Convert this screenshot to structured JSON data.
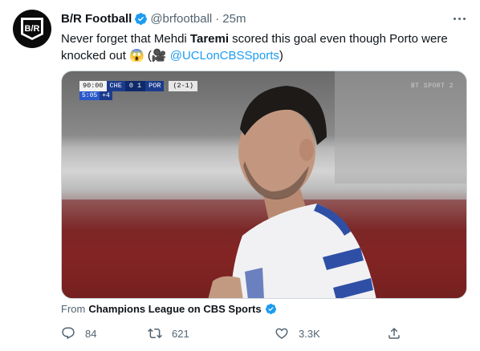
{
  "tweet": {
    "author_name": "B/R Football",
    "handle": "@brfootball",
    "separator": "·",
    "time": "25m",
    "text": {
      "part1": "Never forget that Mehdi ",
      "bold": "Taremi",
      "part2": " scored this goal even though Porto were knocked out 😱 (🎥 ",
      "mention": "@UCLonCBSSports",
      "part3": ")"
    }
  },
  "media": {
    "scorebug": {
      "clock": "90:00",
      "home": "CHE",
      "score": "0  1",
      "away": "POR",
      "aggregate": "(2-1)",
      "added_time": "5:05",
      "added_extra": "+4"
    },
    "broadcast_tag": "BT SPORT 2"
  },
  "from": {
    "label": "From",
    "source": "Champions League on CBS Sports"
  },
  "actions": {
    "replies": "84",
    "retweets": "621",
    "likes": "3.3K"
  },
  "colors": {
    "accent": "#1d9bf0",
    "muted": "#536471",
    "verified": "#1d9bf0"
  },
  "icons": [
    "br-logo",
    "verified-badge-icon",
    "more-icon",
    "reply-icon",
    "retweet-icon",
    "like-icon",
    "share-icon"
  ]
}
